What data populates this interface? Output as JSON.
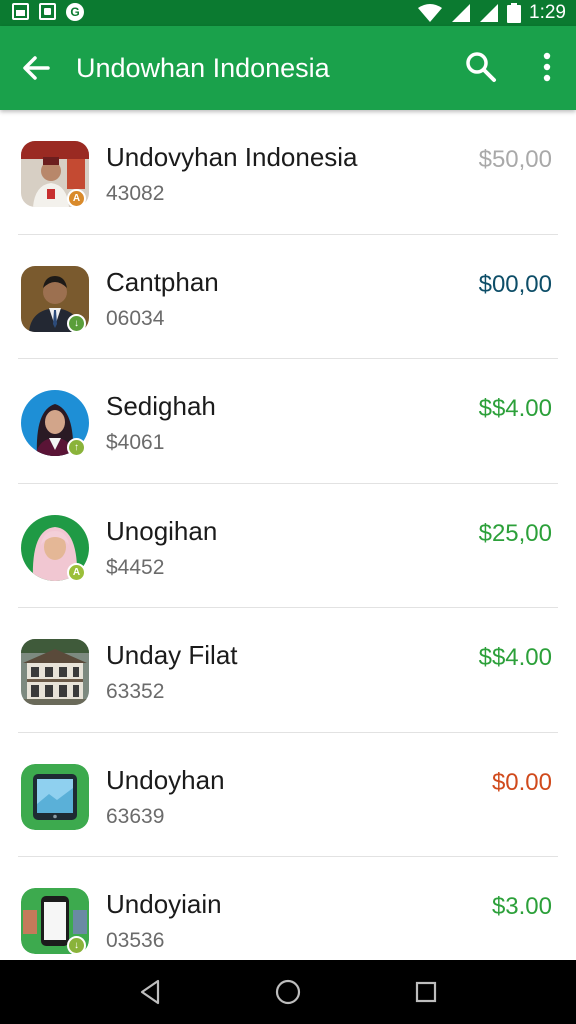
{
  "status_bar": {
    "time": "1:29",
    "left_icons": [
      "gallery-icon",
      "photo-icon",
      "g-icon"
    ],
    "right_icons": [
      "wifi-icon",
      "signal-icon",
      "signal-icon",
      "battery-icon"
    ]
  },
  "app_bar": {
    "title": "Undowhan Indonesia",
    "back_icon": "arrow-left-icon",
    "search_icon": "search-icon",
    "more_icon": "more-vert-icon",
    "background": "#1aa14b"
  },
  "items": [
    {
      "title": "Undovyhan Indonesia",
      "subtitle": "43082",
      "amount": "$50,00",
      "amount_color": "#a9a9a9",
      "badge": "A",
      "badge_color": "#d98a2b",
      "avatar": "person-red-icon"
    },
    {
      "title": "Cantphan",
      "subtitle": "06034",
      "amount": "$00,00",
      "amount_color": "#0e4e68",
      "badge": "↓",
      "badge_color": "#5a9e3a",
      "avatar": "person-suit-icon"
    },
    {
      "title": "Sedighah",
      "subtitle": "$4061",
      "amount": "$$4.00",
      "amount_color": "#2ca03a",
      "badge": "↑",
      "badge_color": "#8ab33a",
      "avatar": "person-hijab-blue-icon"
    },
    {
      "title": "Unogihan",
      "subtitle": "$4452",
      "amount": "$25,00",
      "amount_color": "#2ca03a",
      "badge": "A",
      "badge_color": "#9bbf3a",
      "avatar": "person-hijab-pink-icon"
    },
    {
      "title": "Unday Filat",
      "subtitle": "63352",
      "amount": "$$4.00",
      "amount_color": "#2ca03a",
      "badge": "",
      "badge_color": "",
      "avatar": "building-icon"
    },
    {
      "title": "Undoyhan",
      "subtitle": "63639",
      "amount": "$0.00",
      "amount_color": "#d04a1c",
      "badge": "",
      "badge_color": "",
      "avatar": "tablet-icon"
    },
    {
      "title": "Undoyiain",
      "subtitle": "03536",
      "amount": "$3.00",
      "amount_color": "#2ca03a",
      "badge": "↓",
      "badge_color": "#8ab33a",
      "avatar": "phone-icon"
    }
  ],
  "nav_bar": {
    "back": "nav-back-icon",
    "home": "nav-home-icon",
    "recents": "nav-recents-icon"
  }
}
